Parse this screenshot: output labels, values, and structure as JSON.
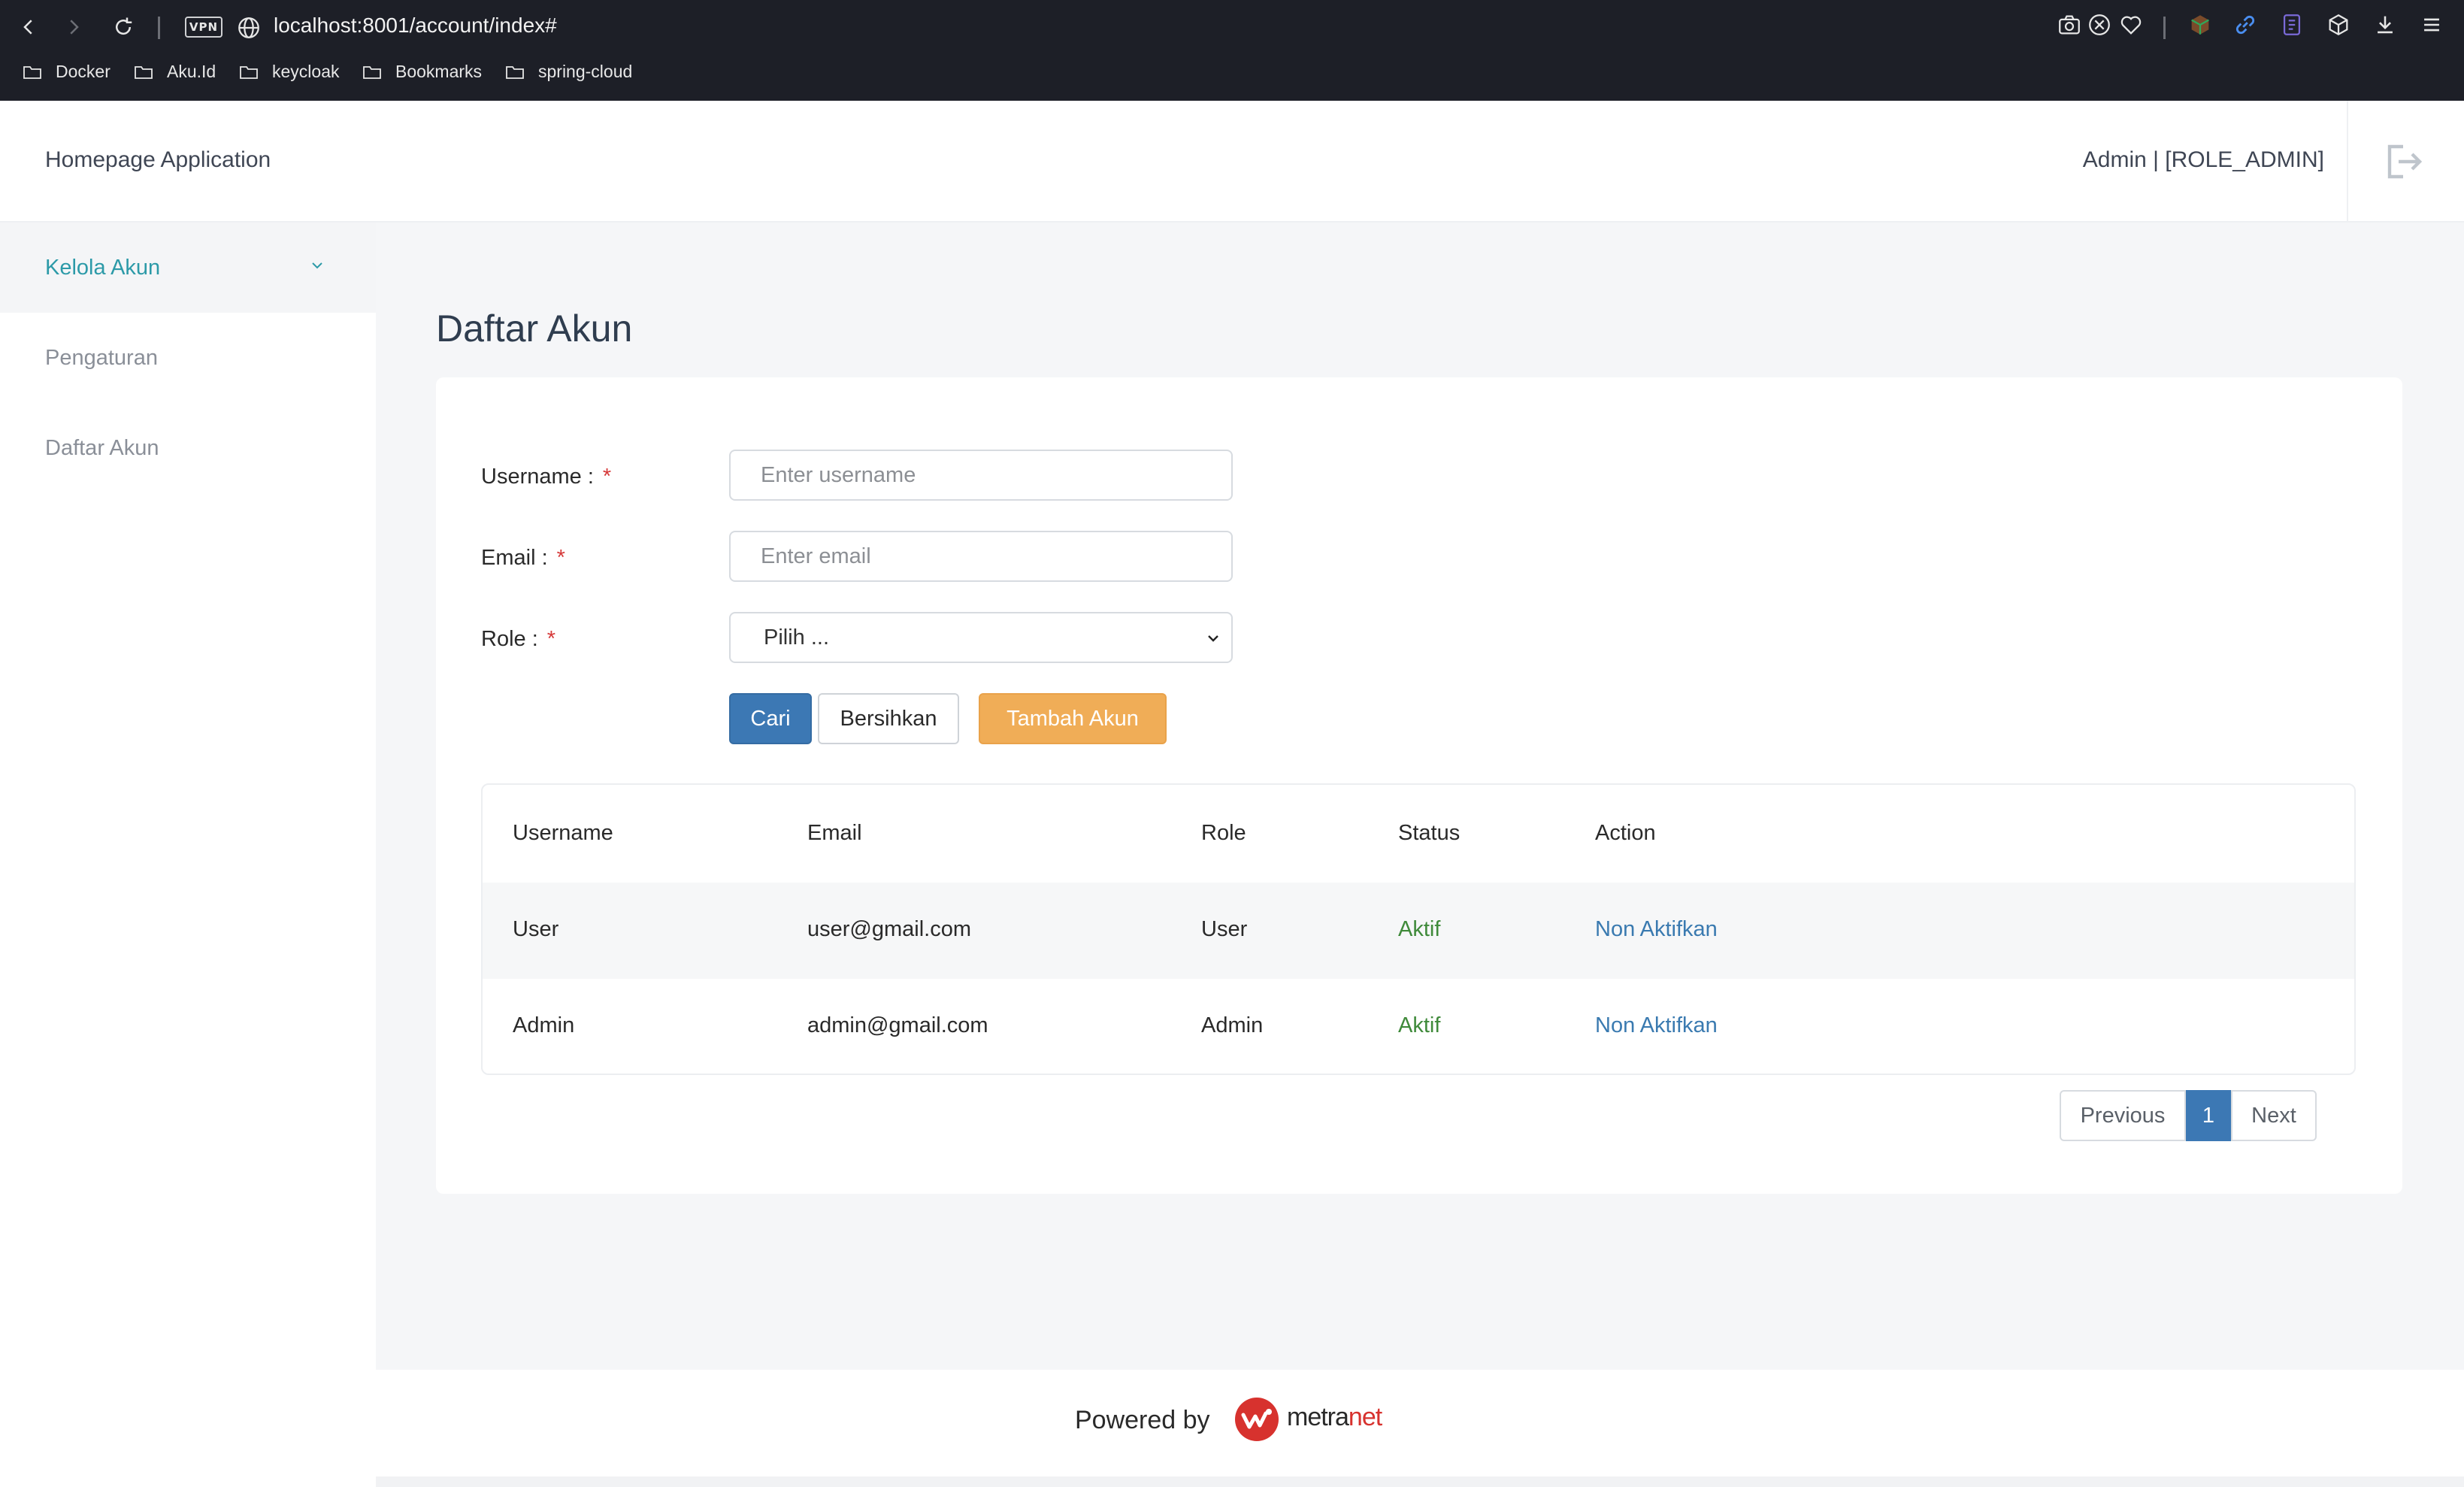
{
  "browser": {
    "url": "localhost:8001/account/index#",
    "vpn_label": "VPN",
    "bookmarks": [
      {
        "label": "Docker"
      },
      {
        "label": "Aku.Id"
      },
      {
        "label": "keycloak"
      },
      {
        "label": "Bookmarks"
      },
      {
        "label": "spring-cloud"
      }
    ]
  },
  "header": {
    "app_title": "Homepage Application",
    "user_label": "Admin | [ROLE_ADMIN]"
  },
  "sidebar": {
    "items": [
      {
        "label": "Kelola Akun",
        "active": true
      },
      {
        "label": "Pengaturan"
      },
      {
        "label": "Daftar Akun"
      }
    ]
  },
  "main": {
    "page_title": "Daftar Akun",
    "form": {
      "username_label": "Username :",
      "username_placeholder": "Enter username",
      "email_label": "Email :",
      "email_placeholder": "Enter email",
      "role_label": "Role :",
      "role_selected": "Pilih ...",
      "required_mark": "*",
      "search_button": "Cari",
      "clear_button": "Bersihkan",
      "add_button": "Tambah Akun"
    },
    "table": {
      "headers": [
        "Username",
        "Email",
        "Role",
        "Status",
        "Action"
      ],
      "rows": [
        {
          "username": "User",
          "email": "user@gmail.com",
          "role": "User",
          "status": "Aktif",
          "action": "Non Aktifkan"
        },
        {
          "username": "Admin",
          "email": "admin@gmail.com",
          "role": "Admin",
          "status": "Aktif",
          "action": "Non Aktifkan"
        }
      ]
    },
    "pagination": {
      "previous": "Previous",
      "current": "1",
      "next": "Next"
    }
  },
  "footer": {
    "powered_by": "Powered by",
    "brand_prefix": "metra",
    "brand_suffix": "net"
  },
  "colors": {
    "primary": "#3c78b4",
    "warning": "#f0ad57",
    "active_sidebar": "#2c9aa8",
    "status_active": "#3f8a3a",
    "required": "#d63a3a"
  }
}
